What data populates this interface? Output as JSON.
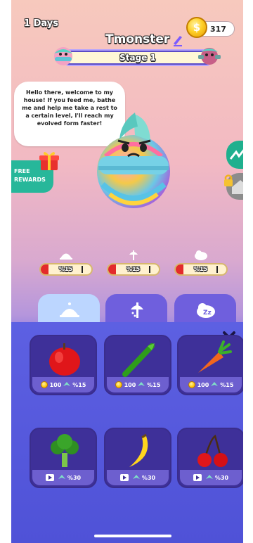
{
  "header": {
    "days": "1 Days",
    "coins": "317",
    "player_name": "Tmonster",
    "stage": "Stage 1"
  },
  "speech": {
    "text": "Hello there, welcome to my house! If you feed me, bathe me and help me take a rest to a certain level, I'll reach my evolved form faster!"
  },
  "free_rewards": {
    "label": "FREE REWARDS"
  },
  "stats": [
    {
      "name": "food",
      "icon": "food-cloche-icon",
      "percent_label": "%15",
      "value": 15
    },
    {
      "name": "clean",
      "icon": "shower-icon",
      "percent_label": "%15",
      "value": 15
    },
    {
      "name": "sleep",
      "icon": "sleep-cloud-icon",
      "percent_label": "%15",
      "value": 15
    }
  ],
  "tabs": [
    {
      "name": "food",
      "icon": "food-cloche-icon",
      "active": true
    },
    {
      "name": "clean",
      "icon": "shower-icon",
      "active": false
    },
    {
      "name": "sleep",
      "icon": "sleep-cloud-icon",
      "active": false
    }
  ],
  "food_items": [
    {
      "name": "apple",
      "icon": "apple-icon",
      "cost_type": "coin",
      "cost": "100",
      "gain": "%15"
    },
    {
      "name": "asparagus",
      "icon": "asparagus-icon",
      "cost_type": "coin",
      "cost": "100",
      "gain": "%15"
    },
    {
      "name": "carrot",
      "icon": "carrot-icon",
      "cost_type": "coin",
      "cost": "100",
      "gain": "%15"
    },
    {
      "name": "broccoli",
      "icon": "broccoli-icon",
      "cost_type": "ad",
      "cost": "",
      "gain": "%30"
    },
    {
      "name": "banana",
      "icon": "banana-icon",
      "cost_type": "ad",
      "cost": "",
      "gain": "%30"
    },
    {
      "name": "cherry",
      "icon": "cherry-icon",
      "cost_type": "ad",
      "cost": "",
      "gain": "%30"
    }
  ],
  "colors": {
    "panel": "#5659dd",
    "card": "#3e3099",
    "tab_active": "#bcd6ff",
    "tab_inactive": "#6f5fdd",
    "stat_fill": "#e32b2b",
    "free_rewards": "#27b79a"
  }
}
